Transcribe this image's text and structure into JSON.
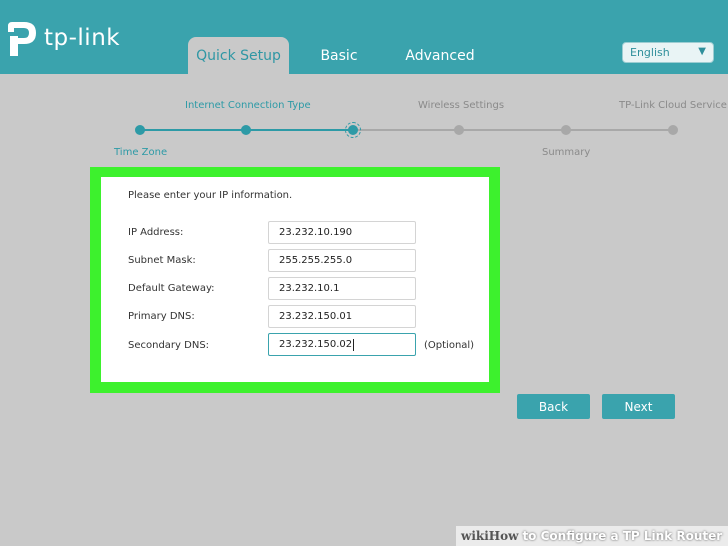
{
  "header": {
    "logo_text": "tp-link",
    "tabs": [
      {
        "label": "Quick Setup",
        "active": true
      },
      {
        "label": "Basic",
        "active": false
      },
      {
        "label": "Advanced",
        "active": false
      }
    ],
    "language": {
      "selected": "English"
    }
  },
  "stepper": {
    "steps": [
      {
        "label": "Time Zone",
        "state": "done"
      },
      {
        "label": "Internet Connection Type",
        "state": "done"
      },
      {
        "label": "",
        "state": "current"
      },
      {
        "label": "Wireless Settings",
        "state": "todo"
      },
      {
        "label": "Summary",
        "state": "todo"
      },
      {
        "label": "TP-Link Cloud Service",
        "state": "todo"
      }
    ],
    "colors": {
      "done": "#2d9aa6",
      "todo": "#9a9a9a"
    }
  },
  "form": {
    "instruction": "Please enter your IP information.",
    "fields": [
      {
        "label": "IP Address:",
        "value": "23.232.10.190"
      },
      {
        "label": "Subnet Mask:",
        "value": "255.255.255.0"
      },
      {
        "label": "Default Gateway:",
        "value": "23.232.10.1"
      },
      {
        "label": "Primary DNS:",
        "value": "23.232.150.01"
      },
      {
        "label": "Secondary DNS:",
        "value": "23.232.150.02",
        "focused": true
      }
    ],
    "optional_note": "(Optional)"
  },
  "buttons": {
    "back": "Back",
    "next": "Next"
  },
  "watermark": {
    "part1": "wiki",
    "part2": "How",
    "part3": "to Configure a TP Link Router"
  },
  "colors": {
    "accent": "#3aa3ad",
    "highlight_frame": "#3df12d",
    "background": "#c9c9c9"
  }
}
